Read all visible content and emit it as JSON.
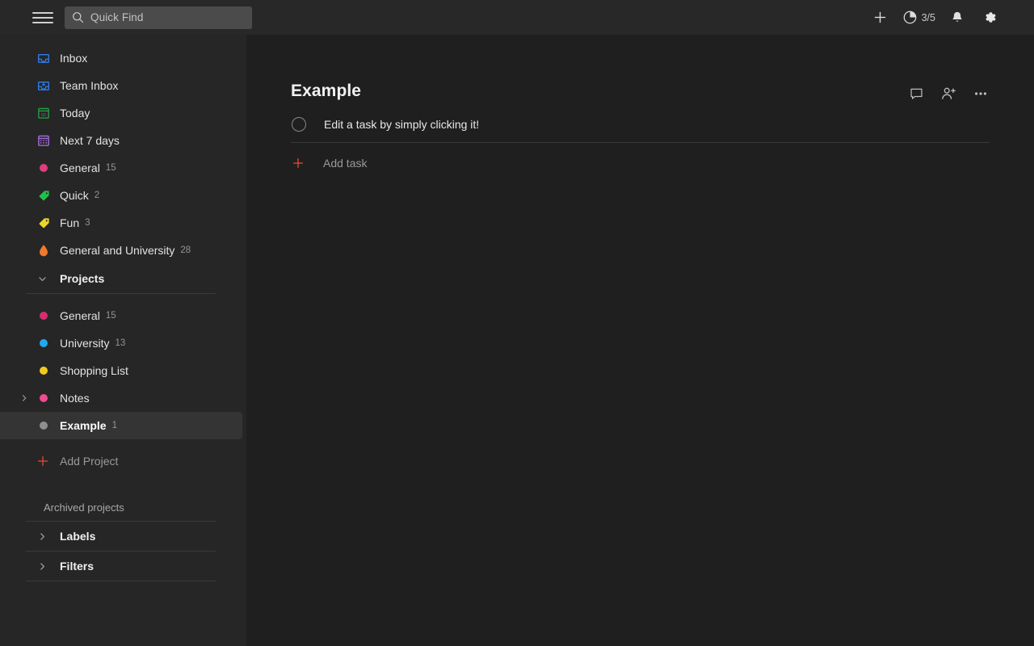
{
  "topbar": {
    "menu_icon": "hamburger-menu-icon",
    "search": {
      "icon": "search-icon",
      "placeholder": "Quick Find",
      "value": ""
    },
    "add_icon": "plus-icon",
    "karma": {
      "icon": "productivity-progress-icon",
      "count": "3/5"
    },
    "notifications_icon": "bell-icon",
    "settings_icon": "gear-icon"
  },
  "sidebar": {
    "nav": [
      {
        "label": "Inbox",
        "icon": "inbox-icon",
        "count": "",
        "color": "#2e7eea"
      },
      {
        "label": "Team Inbox",
        "icon": "team-inbox-icon",
        "count": "",
        "color": "#2e7eea"
      },
      {
        "label": "Today",
        "icon": "today-icon",
        "count": "",
        "color": "#25a244"
      },
      {
        "label": "Next 7 days",
        "icon": "next-7-days-icon",
        "count": "",
        "color": "#a96fe0"
      },
      {
        "label": "General",
        "icon": "dot-icon",
        "count": "15",
        "color": "#de3e80"
      },
      {
        "label": "Quick",
        "icon": "label-tag-icon",
        "count": "2",
        "color": "#21c04a"
      },
      {
        "label": "Fun",
        "icon": "label-tag-icon",
        "count": "3",
        "color": "#ebd52e"
      },
      {
        "label": "General and University",
        "icon": "filter-flame-icon",
        "count": "28",
        "color": "#f0792b"
      }
    ],
    "projects_section": {
      "label": "Projects",
      "chevron": "chevron-down-icon",
      "items": [
        {
          "label": "General",
          "icon": "dot-icon",
          "count": "15",
          "color": "#d62e6e",
          "expandable": false,
          "selected": false
        },
        {
          "label": "University",
          "icon": "dot-icon",
          "count": "13",
          "color": "#22a8f0",
          "expandable": false,
          "selected": false
        },
        {
          "label": "Shopping List",
          "icon": "dot-icon",
          "count": "",
          "color": "#f2cb1d",
          "expandable": false,
          "selected": false
        },
        {
          "label": "Notes",
          "icon": "dot-icon",
          "count": "",
          "color": "#ef4c92",
          "expandable": true,
          "selected": false
        },
        {
          "label": "Example",
          "icon": "dot-icon",
          "count": "1",
          "color": "#8f8f8f",
          "expandable": false,
          "selected": true
        }
      ]
    },
    "add_project": {
      "label": "Add Project",
      "icon": "plus-icon"
    },
    "archived_projects": {
      "label": "Archived projects"
    },
    "labels_section": {
      "label": "Labels",
      "chevron": "chevron-right-icon"
    },
    "filters_section": {
      "label": "Filters",
      "chevron": "chevron-right-icon"
    }
  },
  "main": {
    "title": "Example",
    "actions": {
      "comments_icon": "comment-bubble-icon",
      "share_icon": "add-person-icon",
      "more_icon": "more-options-icon"
    },
    "tasks": [
      {
        "text": "Edit a task by simply clicking it!",
        "checked": false
      }
    ],
    "add_task": {
      "label": "Add task",
      "icon": "plus-icon"
    }
  },
  "colors": {
    "topbar_bg": "#282828",
    "sidebar_bg": "#262626",
    "main_bg": "#1f1f1f",
    "accent_red": "#dd4b39",
    "selected_bg": "#343434",
    "divider": "#3a3a3a"
  }
}
